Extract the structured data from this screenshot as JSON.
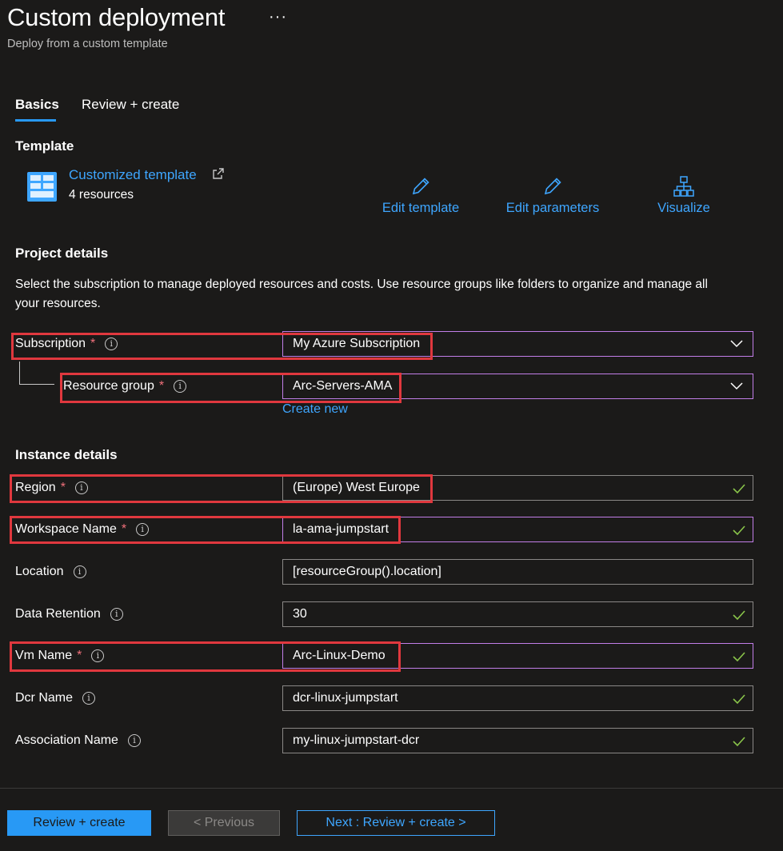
{
  "header": {
    "title": "Custom deployment",
    "more": "···",
    "subtitle": "Deploy from a custom template"
  },
  "tabs": [
    {
      "label": "Basics",
      "selected": true
    },
    {
      "label": "Review + create",
      "selected": false
    }
  ],
  "template": {
    "heading": "Template",
    "link_label": "Customized template",
    "resources": "4 resources",
    "actions": {
      "edit_template": "Edit template",
      "edit_parameters": "Edit parameters",
      "visualize": "Visualize"
    }
  },
  "project": {
    "heading": "Project details",
    "description": "Select the subscription to manage deployed resources and costs. Use resource groups like folders to organize and manage all your resources.",
    "subscription": {
      "label": "Subscription",
      "value": "My Azure Subscription"
    },
    "resource_group": {
      "label": "Resource group",
      "value": "Arc-Servers-AMA",
      "create_new": "Create new"
    }
  },
  "instance": {
    "heading": "Instance details",
    "fields": {
      "region": {
        "label": "Region",
        "value": "(Europe) West Europe"
      },
      "workspace_name": {
        "label": "Workspace Name",
        "value": "la-ama-jumpstart"
      },
      "location": {
        "label": "Location",
        "value": "[resourceGroup().location]"
      },
      "data_retention": {
        "label": "Data Retention",
        "value": "30"
      },
      "vm_name": {
        "label": "Vm Name",
        "value": "Arc-Linux-Demo"
      },
      "dcr_name": {
        "label": "Dcr Name",
        "value": "dcr-linux-jumpstart"
      },
      "association_name": {
        "label": "Association Name",
        "value": "my-linux-jumpstart-dcr"
      }
    }
  },
  "footer": {
    "review_create": "Review + create",
    "previous": "< Previous",
    "next": "Next : Review + create >"
  },
  "colors": {
    "background": "#1b1a19",
    "accent": "#2899f5",
    "link": "#3ea6ff",
    "highlight": "#e0383e",
    "valid": "#8ac54a",
    "required": "#f1707b"
  },
  "icons": {
    "template": "template-grid-icon",
    "external": "external-link-icon",
    "edit": "pencil-icon",
    "visualize": "hierarchy-icon",
    "dropdown": "chevron-down-icon",
    "valid": "checkmark-icon",
    "info": "info-icon"
  }
}
